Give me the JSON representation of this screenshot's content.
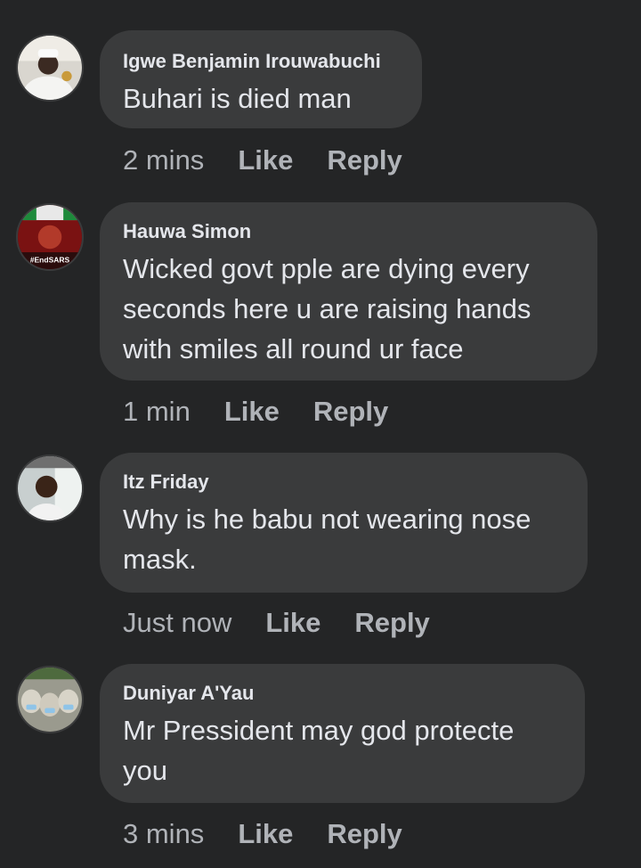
{
  "comments": [
    {
      "author": "Igwe Benjamin Irouwabuchi",
      "text": "Buhari is died man",
      "time": "2 mins",
      "like": "Like",
      "reply": "Reply",
      "avatar_icon": "user-photo-white-cap"
    },
    {
      "author": "Hauwa Simon",
      "text": "Wicked govt pple are dying every seconds here u are raising hands with smiles all round ur face",
      "time": "1 min",
      "like": "Like",
      "reply": "Reply",
      "avatar_icon": "endsars-photo",
      "avatar_badge": "#EndSARS"
    },
    {
      "author": "Itz Friday",
      "text": "Why is he babu not wearing nose mask.",
      "time": "Just now",
      "like": "Like",
      "reply": "Reply",
      "avatar_icon": "user-photo-car"
    },
    {
      "author": "Duniyar A'Yau",
      "text": "Mr Pressident may god protecte you",
      "time": "3 mins",
      "like": "Like",
      "reply": "Reply",
      "avatar_icon": "sheep-with-masks-photo"
    }
  ],
  "colors": {
    "background": "#242526",
    "bubble": "#3a3b3c",
    "primary_text": "#e4e6eb",
    "secondary_text": "#b0b3b8"
  }
}
